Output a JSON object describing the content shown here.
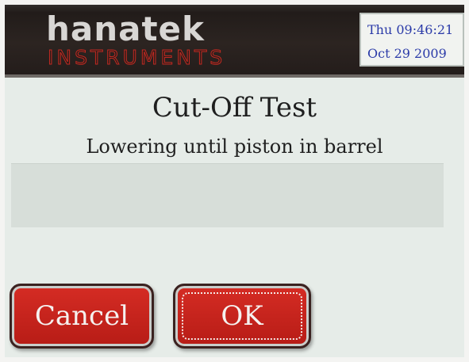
{
  "header": {
    "brand_name": "hanatek",
    "brand_sub": "INSTRUMENTS",
    "clock_line1": "Thu 09:46:21",
    "clock_line2": "Oct 29  2009"
  },
  "main": {
    "title": "Cut-Off Test",
    "status": "Lowering until piston in barrel",
    "message": ""
  },
  "buttons": {
    "cancel_label": "Cancel",
    "ok_label": "OK"
  },
  "colors": {
    "header_bg": "#241d1b",
    "accent_red": "#c22a22",
    "clock_text": "#2a3aa8",
    "screen_bg": "#e6ece8"
  }
}
